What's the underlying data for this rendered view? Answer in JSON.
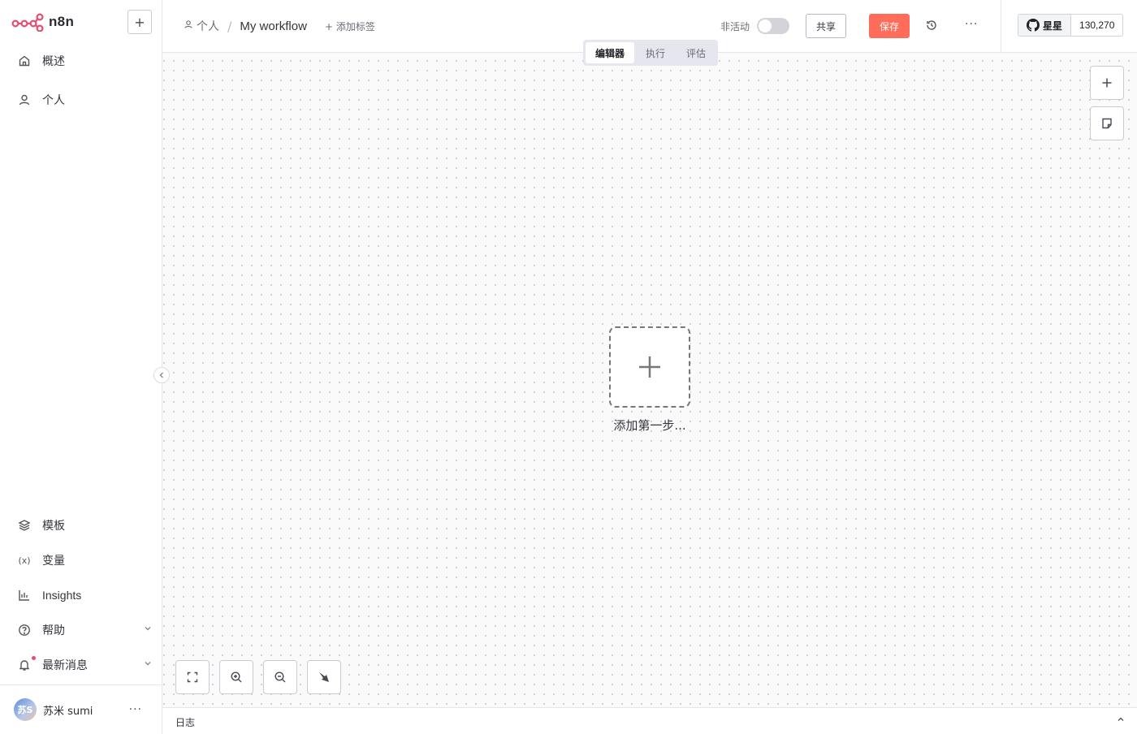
{
  "app": {
    "name": "n8n"
  },
  "sidebar": {
    "top_items": [
      {
        "label": "概述",
        "icon": "home-icon"
      },
      {
        "label": "个人",
        "icon": "user-icon"
      }
    ],
    "bottom_items": [
      {
        "label": "模板",
        "icon": "templates-icon"
      },
      {
        "label": "变量",
        "icon": "variables-icon"
      },
      {
        "label": "Insights",
        "icon": "insights-icon"
      },
      {
        "label": "帮助",
        "icon": "help-icon"
      },
      {
        "label": "最新消息",
        "icon": "bell-icon"
      }
    ],
    "user": {
      "initials": "苏S",
      "name": "苏米 sumi"
    }
  },
  "header": {
    "breadcrumb_project": "个人",
    "workflow_name": "My workflow",
    "add_tag": "+ 添加标签",
    "inactive_label": "非活动",
    "share": "共享",
    "save": "保存",
    "github_star": "星星",
    "github_count": "130,270"
  },
  "tabs": [
    {
      "label": "编辑器",
      "active": true
    },
    {
      "label": "执行",
      "active": false
    },
    {
      "label": "评估",
      "active": false
    }
  ],
  "canvas": {
    "add_first_step": "添加第一步..."
  },
  "logs": {
    "label": "日志"
  },
  "colors": {
    "accent": "#ff6d5a",
    "brand": "#ea4b71"
  }
}
